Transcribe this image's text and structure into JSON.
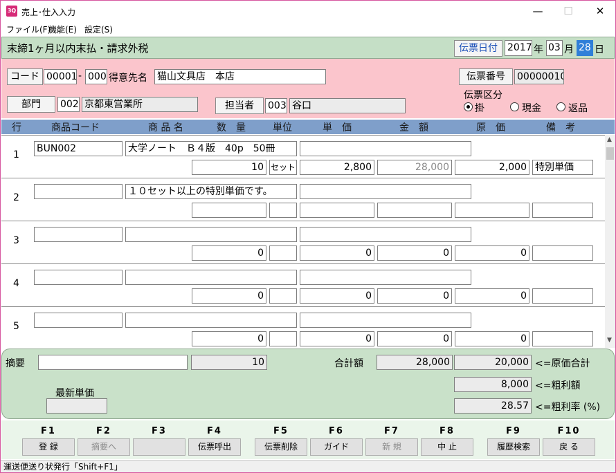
{
  "window": {
    "title": "売上･仕入入力",
    "app_icon": "3Q",
    "minimize": "—",
    "maximize": "☐",
    "close": "✕"
  },
  "menu": [
    "ファイル(F)",
    "機能(E)",
    "設定(S)"
  ],
  "header": {
    "terms": "末締1ヶ月以内末払・請求外税",
    "date_label": "伝票日付",
    "year": "2017",
    "year_unit": "年",
    "month": "03",
    "month_unit": "月",
    "day": "28",
    "day_unit": "日"
  },
  "customer": {
    "code_label": "コード",
    "code1": "00001",
    "sep": "-",
    "code2": "000",
    "name_label": "得意先名",
    "name": "猫山文具店　本店",
    "slip_no_label": "伝票番号",
    "slip_no": "00000010",
    "dept_label": "部門",
    "dept_code": "002",
    "dept_name": "京都東営業所",
    "staff_label": "担当者",
    "staff_code": "003",
    "staff_name": "谷口",
    "slip_type_label": "伝票区分",
    "slip_types": [
      "掛",
      "現金",
      "返品"
    ],
    "slip_type_selected": "掛"
  },
  "columns": [
    "行",
    "商品コード",
    "商 品 名",
    "数　量",
    "単位",
    "単　価",
    "金　額",
    "原　価",
    "備　考"
  ],
  "rows": [
    {
      "no": "1",
      "code": "BUN002",
      "name": "大学ノート　Ｂ４版　40p　50冊",
      "memo_line": "",
      "qty": "10",
      "unit": "セット",
      "price": "2,800",
      "amount": "28,000",
      "cost": "2,000",
      "note": "特別単価"
    },
    {
      "no": "2",
      "code": "",
      "name": "１０セット以上の特別単価です。",
      "memo_line": "",
      "qty": "",
      "unit": "",
      "price": "",
      "amount": "",
      "cost": "",
      "note": ""
    },
    {
      "no": "3",
      "code": "",
      "name": "",
      "memo_line": "",
      "qty": "0",
      "unit": "",
      "price": "0",
      "amount": "0",
      "cost": "0",
      "note": ""
    },
    {
      "no": "4",
      "code": "",
      "name": "",
      "memo_line": "",
      "qty": "0",
      "unit": "",
      "price": "0",
      "amount": "0",
      "cost": "0",
      "note": ""
    },
    {
      "no": "5",
      "code": "",
      "name": "",
      "memo_line": "",
      "qty": "0",
      "unit": "",
      "price": "0",
      "amount": "0",
      "cost": "0",
      "note": ""
    }
  ],
  "summary": {
    "memo_label": "摘要",
    "memo": "",
    "qty_total": "10",
    "total_label": "合計額",
    "total": "28,000",
    "cost_total": "20,000",
    "cost_total_label": "<=原価合計",
    "profit": "8,000",
    "profit_label": "<=粗利額",
    "latest_price_label": "最新単価",
    "latest_price": "",
    "margin": "28.57",
    "margin_label": "<=粗利率 (%)"
  },
  "fkeys": [
    {
      "key": "F1",
      "label": "登 録",
      "enabled": true
    },
    {
      "key": "F2",
      "label": "摘要へ",
      "enabled": false
    },
    {
      "key": "F3",
      "label": "",
      "enabled": false
    },
    {
      "key": "F4",
      "label": "伝票呼出",
      "enabled": true
    },
    {
      "key": "F5",
      "label": "伝票削除",
      "enabled": true
    },
    {
      "key": "F6",
      "label": "ガイド",
      "enabled": true
    },
    {
      "key": "F7",
      "label": "新 規",
      "enabled": false
    },
    {
      "key": "F8",
      "label": "中 止",
      "enabled": true
    },
    {
      "key": "F9",
      "label": "履歴検索",
      "enabled": true
    },
    {
      "key": "F10",
      "label": "戻 る",
      "enabled": true
    }
  ],
  "status": "運送便送り状発行「Shift+F1」"
}
